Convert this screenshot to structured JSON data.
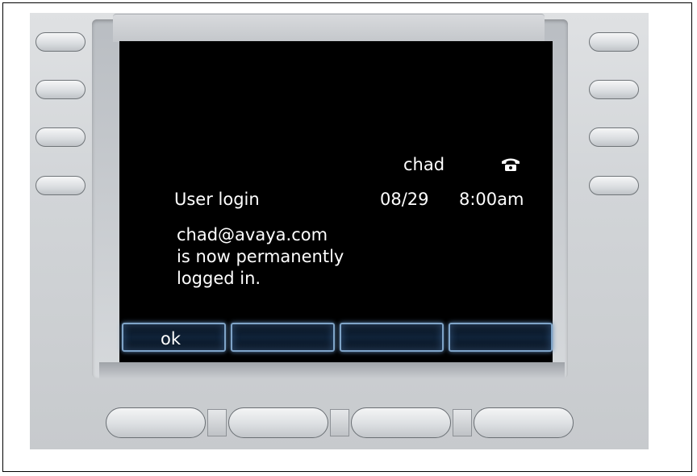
{
  "header": {
    "user_name": "chad",
    "date": "08/29",
    "time": "8:00am",
    "status_icon": "phone-icon"
  },
  "screen": {
    "title": "User login",
    "message_lines": [
      "chad@avaya.com",
      "is now permanently",
      "logged in."
    ]
  },
  "softkeys": [
    {
      "label": "ok"
    },
    {
      "label": ""
    },
    {
      "label": ""
    },
    {
      "label": ""
    }
  ],
  "colors": {
    "screen_bg": "#000000",
    "text": "#ffffff",
    "softkey_glow": "#7fa4c8"
  }
}
